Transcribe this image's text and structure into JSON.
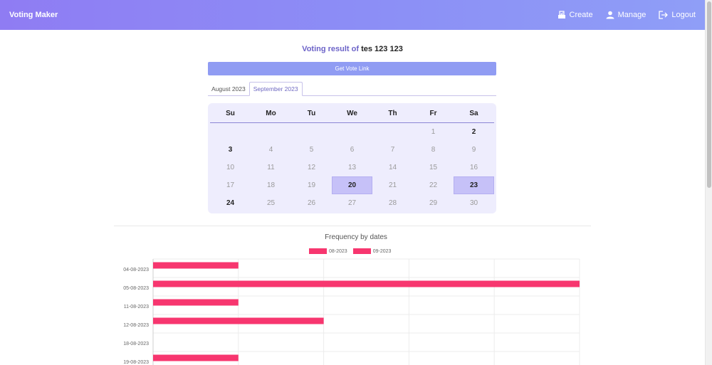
{
  "navbar": {
    "brand": "Voting Maker",
    "links": [
      {
        "label": "Create",
        "icon": "create-icon"
      },
      {
        "label": "Manage",
        "icon": "user-icon"
      },
      {
        "label": "Logout",
        "icon": "logout-icon"
      }
    ]
  },
  "result": {
    "label": "Voting result of",
    "name": "tes 123 123",
    "link_button": "Get Vote Link"
  },
  "tabs": [
    {
      "label": "August 2023",
      "active": false
    },
    {
      "label": "September 2023",
      "active": true
    }
  ],
  "calendar": {
    "weekdays": [
      "Su",
      "Mo",
      "Tu",
      "We",
      "Th",
      "Fr",
      "Sa"
    ],
    "weeks": [
      [
        null,
        null,
        null,
        null,
        null,
        "1",
        "2"
      ],
      [
        "3",
        "4",
        "5",
        "6",
        "7",
        "8",
        "9"
      ],
      [
        "10",
        "11",
        "12",
        "13",
        "14",
        "15",
        "16"
      ],
      [
        "17",
        "18",
        "19",
        "20",
        "21",
        "22",
        "23"
      ],
      [
        "24",
        "25",
        "26",
        "27",
        "28",
        "29",
        "30"
      ]
    ],
    "bold_days": [
      "2",
      "3",
      "24"
    ],
    "selected_days": [
      "20",
      "23"
    ]
  },
  "colors": {
    "accent": "#8f8bf5",
    "bar": "#f7366f",
    "selected_day": "#c6c1f8",
    "calendar_bg": "#eeedfd"
  },
  "chart_data": {
    "type": "bar",
    "orientation": "horizontal",
    "title": "Frequency by dates",
    "categories": [
      "04-08-2023",
      "05-08-2023",
      "11-08-2023",
      "12-08-2023",
      "18-08-2023",
      "19-08-2023"
    ],
    "series": [
      {
        "name": "08-2023",
        "color": "#f7366f",
        "values": [
          1,
          5,
          1,
          2,
          0,
          1
        ]
      },
      {
        "name": "09-2023",
        "color": "#f7366f",
        "values": [
          0,
          0,
          0,
          0,
          0,
          0
        ]
      }
    ],
    "xlim": [
      0,
      5
    ],
    "grid": true,
    "legend": "top"
  }
}
